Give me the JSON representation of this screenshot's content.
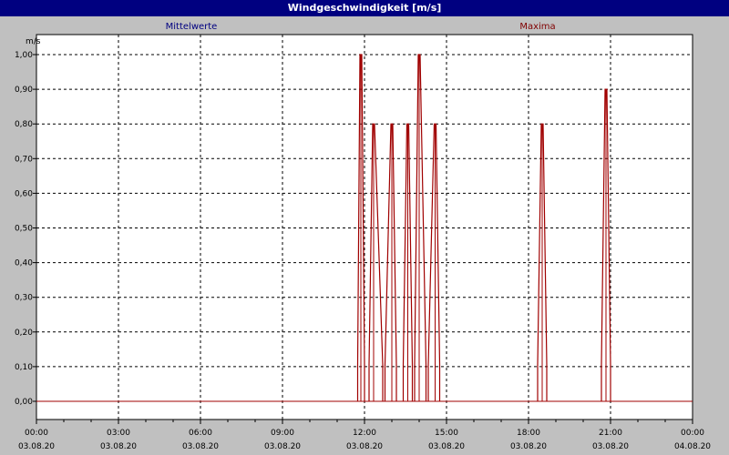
{
  "window": {
    "title": "Windgeschwindigkeit [m/s]"
  },
  "legend": {
    "left": "Mittelwerte",
    "right": "Maxima"
  },
  "colors": {
    "titlebar": "#000080",
    "background": "#c0c0c0",
    "plot_background": "#ffffff",
    "grid": "#000000",
    "series_max": "#a00000",
    "legend_mean": "#000080",
    "legend_max": "#800000"
  },
  "chart_data": {
    "type": "line",
    "title": "Windgeschwindigkeit [m/s]",
    "ylabel": "m/s",
    "xlabel": "",
    "ylim": [
      0,
      1.05
    ],
    "xlim_hours": [
      0,
      24
    ],
    "grid": true,
    "y_ticks": [
      "0,00",
      "0,10",
      "0,20",
      "0,30",
      "0,40",
      "0,50",
      "0,60",
      "0,70",
      "0,80",
      "0,90",
      "1,00"
    ],
    "x_ticks": [
      {
        "time": "00:00",
        "date": "03.08.20"
      },
      {
        "time": "03:00",
        "date": "03.08.20"
      },
      {
        "time": "06:00",
        "date": "03.08.20"
      },
      {
        "time": "09:00",
        "date": "03.08.20"
      },
      {
        "time": "12:00",
        "date": "03.08.20"
      },
      {
        "time": "15:00",
        "date": "03.08.20"
      },
      {
        "time": "18:00",
        "date": "03.08.20"
      },
      {
        "time": "21:00",
        "date": "03.08.20"
      },
      {
        "time": "00:00",
        "date": "04.08.20"
      }
    ],
    "series": [
      {
        "name": "Maxima",
        "peaks": [
          {
            "start": "11:45",
            "peak": "11:52",
            "end": "12:00",
            "value": 1.0
          },
          {
            "start": "12:10",
            "peak": "12:20",
            "end": "12:40",
            "value": 0.8
          },
          {
            "start": "12:45",
            "peak": "13:00",
            "end": "13:10",
            "value": 0.8
          },
          {
            "start": "13:25",
            "peak": "13:35",
            "end": "13:45",
            "value": 0.8
          },
          {
            "start": "13:50",
            "peak": "14:00",
            "end": "14:15",
            "value": 1.0
          },
          {
            "start": "14:20",
            "peak": "14:35",
            "end": "14:45",
            "value": 0.8
          },
          {
            "start": "18:20",
            "peak": "18:30",
            "end": "18:40",
            "value": 0.8
          },
          {
            "start": "20:40",
            "peak": "20:50",
            "end": "21:00",
            "value": 0.9
          }
        ]
      }
    ]
  }
}
